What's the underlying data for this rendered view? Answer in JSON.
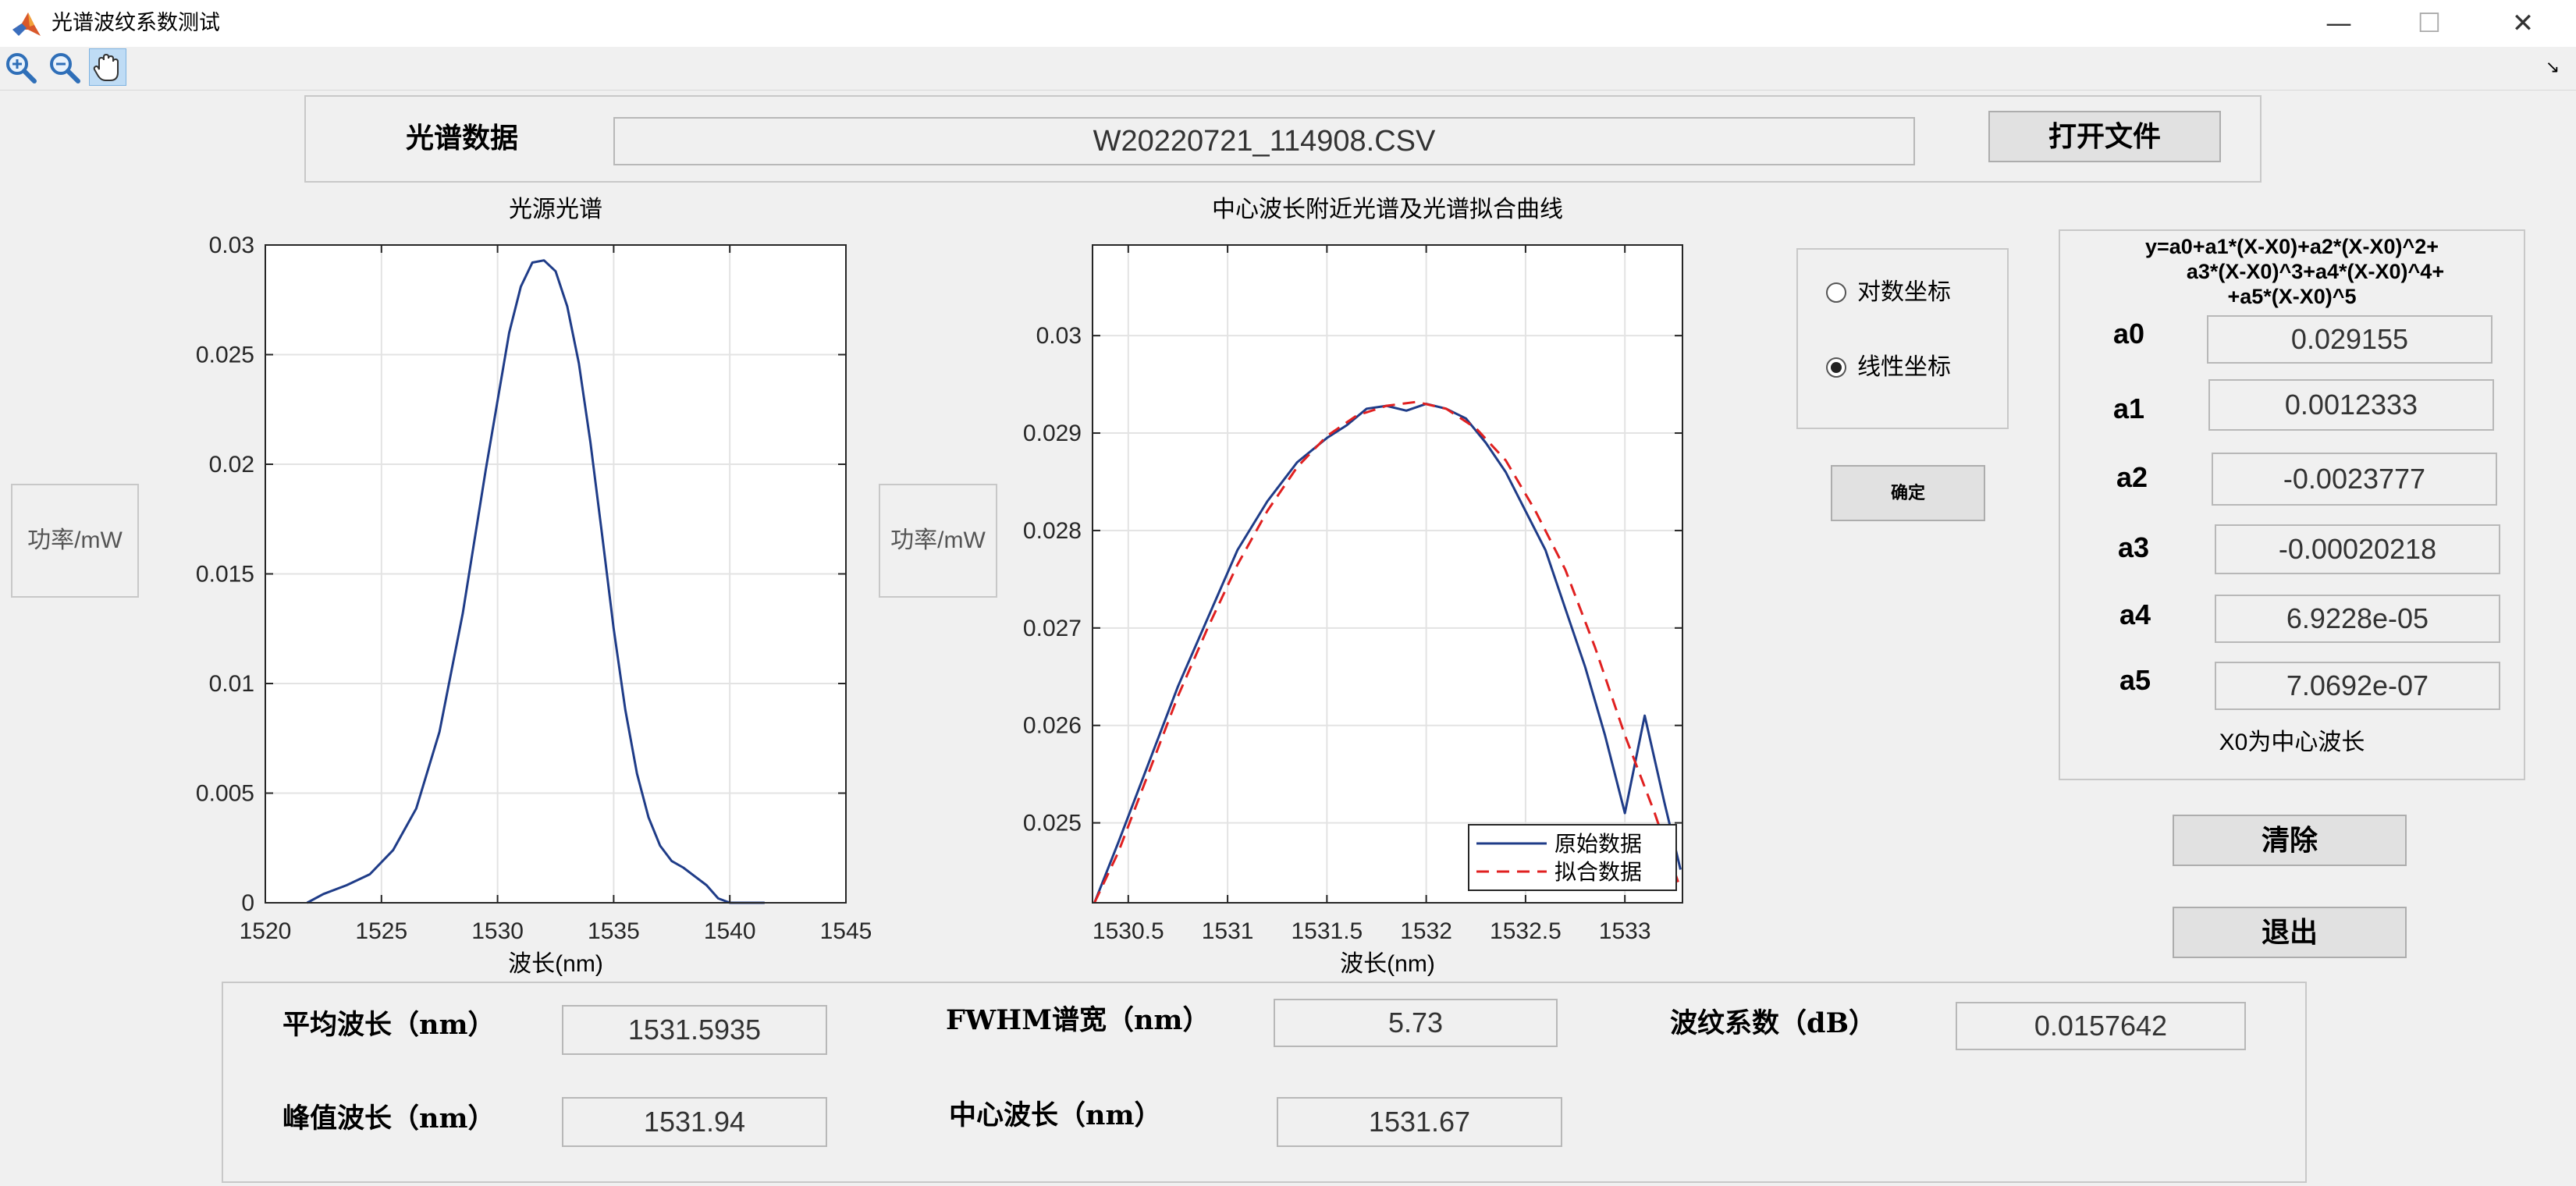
{
  "window": {
    "title": "光谱波纹系数测试",
    "min_glyph": "—",
    "max_glyph": "☐",
    "close_glyph": "✕"
  },
  "toolbar": {
    "zoom_in_icon": "zoom-in-icon",
    "zoom_out_icon": "zoom-out-icon",
    "pan_icon": "pan-hand-icon",
    "dock_glyph": "↘"
  },
  "file_panel": {
    "label": "光谱数据",
    "filename": "W20220721_114908.CSV",
    "open_button": "打开文件"
  },
  "y_label_left": "功率/mW",
  "y_label_right": "功率/mW",
  "scale_options": {
    "log": "对数坐标",
    "linear": "线性坐标",
    "selected": "linear"
  },
  "confirm_button": "确定",
  "formula": {
    "line1": "y=a0+a1*(X-X0)+a2*(X-X0)^2+",
    "line2": "a3*(X-X0)^3+a4*(X-X0)^4+",
    "line3": "+a5*(X-X0)^5",
    "coefficients": [
      {
        "name": "a0",
        "value": "0.029155"
      },
      {
        "name": "a1",
        "value": "0.0012333"
      },
      {
        "name": "a2",
        "value": "-0.0023777"
      },
      {
        "name": "a3",
        "value": "-0.00020218"
      },
      {
        "name": "a4",
        "value": "6.9228e-05"
      },
      {
        "name": "a5",
        "value": "7.0692e-07"
      }
    ],
    "note": "X0为中心波长"
  },
  "clear_button": "清除",
  "exit_button": "退出",
  "results": {
    "mean_wl_label": "平均波长（nm）",
    "mean_wl_value": "1531.5935",
    "fwhm_label": "FWHM谱宽（nm）",
    "fwhm_value": "5.73",
    "ripple_label": "波纹系数（dB）",
    "ripple_value": "0.0157642",
    "peak_wl_label": "峰值波长（nm）",
    "peak_wl_value": "1531.94",
    "center_wl_label": "中心波长（nm）",
    "center_wl_value": "1531.67"
  },
  "chart_data": [
    {
      "type": "line",
      "title": "光源光谱",
      "xlabel": "波长(nm)",
      "ylabel": "",
      "xlim": [
        1520,
        1545
      ],
      "ylim": [
        0,
        0.03
      ],
      "xticks": [
        1520,
        1525,
        1530,
        1535,
        1540,
        1545
      ],
      "xtick_labels": [
        "1520",
        "1525",
        "1530",
        "1535",
        "1540",
        "1545"
      ],
      "yticks": [
        0,
        0.005,
        0.01,
        0.015,
        0.02,
        0.025,
        0.03
      ],
      "ytick_labels": [
        "0",
        "0.005",
        "0.01",
        "0.015",
        "0.02",
        "0.025",
        "0.03"
      ],
      "grid": true,
      "series": [
        {
          "color": "#1f3c88",
          "x": [
            1521.8,
            1522.5,
            1523.5,
            1524.5,
            1525.5,
            1526.5,
            1527.5,
            1528.5,
            1529.5,
            1530.5,
            1531.0,
            1531.5,
            1532.0,
            1532.5,
            1533.0,
            1533.5,
            1534.0,
            1534.5,
            1535.0,
            1535.5,
            1536.0,
            1536.5,
            1537.0,
            1537.5,
            1538.0,
            1538.5,
            1539.0,
            1539.5,
            1540.0,
            1540.5,
            1541.0,
            1541.5
          ],
          "y": [
            0.0,
            0.0004,
            0.0008,
            0.0013,
            0.0024,
            0.0043,
            0.0078,
            0.0132,
            0.0198,
            0.026,
            0.0281,
            0.0292,
            0.0293,
            0.0288,
            0.0272,
            0.0246,
            0.021,
            0.0168,
            0.0125,
            0.0088,
            0.0059,
            0.0039,
            0.0026,
            0.0019,
            0.0016,
            0.0012,
            0.0008,
            0.0002,
            0.0,
            0.0,
            0.0,
            0.0
          ]
        }
      ]
    },
    {
      "type": "line",
      "title": "中心波长附近光谱及光谱拟合曲线",
      "xlabel": "波长(nm)",
      "ylabel": "",
      "xlim": [
        1530.32,
        1533.29
      ],
      "ylim": [
        0.02418,
        0.03093
      ],
      "xticks": [
        1530.5,
        1531,
        1531.5,
        1532,
        1532.5,
        1533
      ],
      "xtick_labels": [
        "1530.5",
        "1531",
        "1531.5",
        "1532",
        "1532.5",
        "1533"
      ],
      "yticks": [
        0.025,
        0.026,
        0.027,
        0.028,
        0.029,
        0.03
      ],
      "ytick_labels": [
        "0.025",
        "0.026",
        "0.027",
        "0.028",
        "0.029",
        "0.03"
      ],
      "grid": true,
      "legend": "bottom-right",
      "series": [
        {
          "name": "原始数据",
          "color": "#1f3c88",
          "dash": false,
          "x": [
            1530.33,
            1530.45,
            1530.6,
            1530.75,
            1530.9,
            1531.05,
            1531.2,
            1531.35,
            1531.5,
            1531.6,
            1531.7,
            1531.8,
            1531.9,
            1532.0,
            1532.1,
            1532.2,
            1532.3,
            1532.4,
            1532.5,
            1532.6,
            1532.7,
            1532.8,
            1532.9,
            1533.0,
            1533.1,
            1533.2,
            1533.28
          ],
          "y": [
            0.02418,
            0.0248,
            0.0256,
            0.0264,
            0.0271,
            0.0278,
            0.0283,
            0.0287,
            0.02895,
            0.02908,
            0.02925,
            0.02928,
            0.02923,
            0.0293,
            0.02925,
            0.02915,
            0.0289,
            0.0286,
            0.0282,
            0.0278,
            0.0272,
            0.0266,
            0.0259,
            0.0251,
            0.0261,
            0.0252,
            0.02452
          ]
        },
        {
          "name": "拟合数据",
          "color": "#e02020",
          "dash": true,
          "x": [
            1530.33,
            1530.45,
            1530.6,
            1530.75,
            1530.9,
            1531.05,
            1531.2,
            1531.35,
            1531.5,
            1531.65,
            1531.8,
            1531.95,
            1532.1,
            1532.25,
            1532.4,
            1532.55,
            1532.7,
            1532.85,
            1533.0,
            1533.15,
            1533.28
          ],
          "y": [
            0.02418,
            0.0247,
            0.0255,
            0.0263,
            0.027,
            0.02765,
            0.0282,
            0.02865,
            0.02897,
            0.02918,
            0.02928,
            0.02932,
            0.02925,
            0.02905,
            0.02872,
            0.0282,
            0.0276,
            0.0268,
            0.0259,
            0.0251,
            0.02432
          ]
        }
      ]
    }
  ]
}
